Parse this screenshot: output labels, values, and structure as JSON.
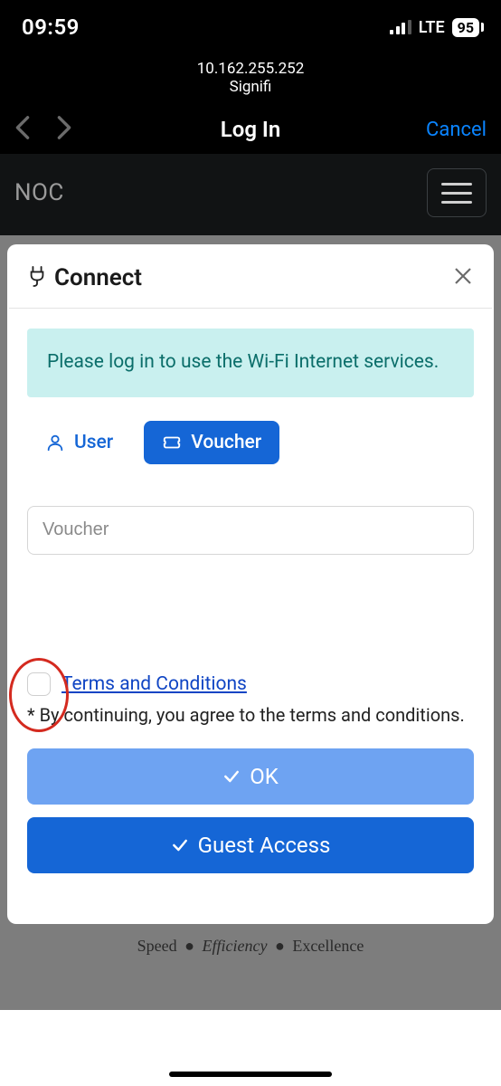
{
  "status": {
    "time": "09:59",
    "network_label": "LTE",
    "battery_percent": "95"
  },
  "captive": {
    "ip": "10.162.255.252",
    "ssid": "Signifi",
    "title": "Log In",
    "cancel": "Cancel"
  },
  "appbar": {
    "brand": "NOC"
  },
  "card": {
    "title": "Connect",
    "info": "Please log in to use the Wi-Fi Internet services.",
    "tabs": {
      "user": "User",
      "voucher": "Voucher"
    },
    "voucher_placeholder": "Voucher",
    "terms_link": "Terms and Conditions",
    "terms_note": "* By continuing, you agree to the terms and conditions.",
    "ok": "OK",
    "guest": "Guest Access"
  },
  "footer": {
    "w1": "Speed",
    "w2": "Efficiency",
    "w3": "Excellence"
  }
}
